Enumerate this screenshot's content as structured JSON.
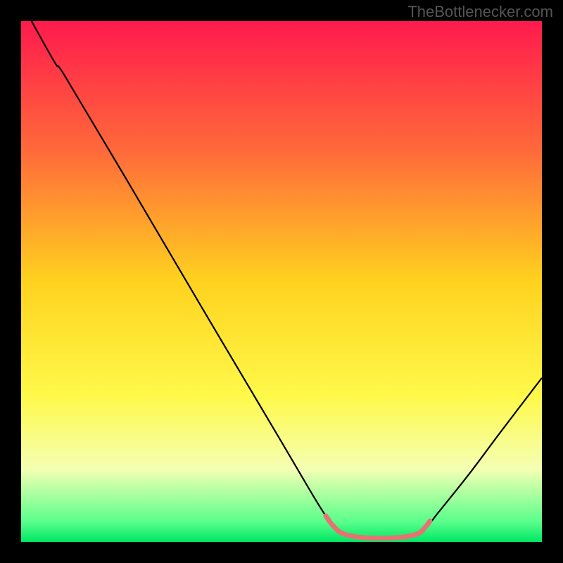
{
  "watermark": "TheBottlenecker.com",
  "chart_data": {
    "type": "line",
    "title": "",
    "xlabel": "",
    "ylabel": "",
    "xlim": [
      0,
      100
    ],
    "ylim": [
      0,
      100
    ],
    "gradient_stops": [
      {
        "offset": 0,
        "color": "#ff1a4d"
      },
      {
        "offset": 25,
        "color": "#ff6a3a"
      },
      {
        "offset": 50,
        "color": "#ffd21f"
      },
      {
        "offset": 72,
        "color": "#fff94a"
      },
      {
        "offset": 86,
        "color": "#f4ffb3"
      },
      {
        "offset": 96,
        "color": "#5cff8c"
      },
      {
        "offset": 100,
        "color": "#00e864"
      }
    ],
    "series": [
      {
        "name": "bottleneck-curve",
        "color": "#000000",
        "points": [
          {
            "x": 2.0,
            "y": 100.0
          },
          {
            "x": 6.5,
            "y": 92.0
          },
          {
            "x": 8.5,
            "y": 89.3
          },
          {
            "x": 20.0,
            "y": 70.0
          },
          {
            "x": 35.0,
            "y": 44.5
          },
          {
            "x": 50.0,
            "y": 19.2
          },
          {
            "x": 56.0,
            "y": 9.0
          },
          {
            "x": 58.5,
            "y": 5.0
          },
          {
            "x": 60.0,
            "y": 3.0
          },
          {
            "x": 62.0,
            "y": 1.5
          },
          {
            "x": 66.0,
            "y": 0.8
          },
          {
            "x": 72.0,
            "y": 0.8
          },
          {
            "x": 76.0,
            "y": 1.5
          },
          {
            "x": 78.0,
            "y": 3.0
          },
          {
            "x": 80.0,
            "y": 5.5
          },
          {
            "x": 86.0,
            "y": 13.0
          },
          {
            "x": 92.0,
            "y": 21.0
          },
          {
            "x": 100.0,
            "y": 31.5
          }
        ]
      },
      {
        "name": "highlight-segment",
        "color": "#e57373",
        "stroke_width": 7,
        "points": [
          {
            "x": 58.5,
            "y": 5.0
          },
          {
            "x": 60.0,
            "y": 3.0
          },
          {
            "x": 62.0,
            "y": 1.5
          },
          {
            "x": 66.0,
            "y": 0.8
          },
          {
            "x": 72.0,
            "y": 0.8
          },
          {
            "x": 76.0,
            "y": 1.5
          },
          {
            "x": 77.5,
            "y": 2.7
          },
          {
            "x": 78.5,
            "y": 4.0
          }
        ]
      }
    ]
  }
}
